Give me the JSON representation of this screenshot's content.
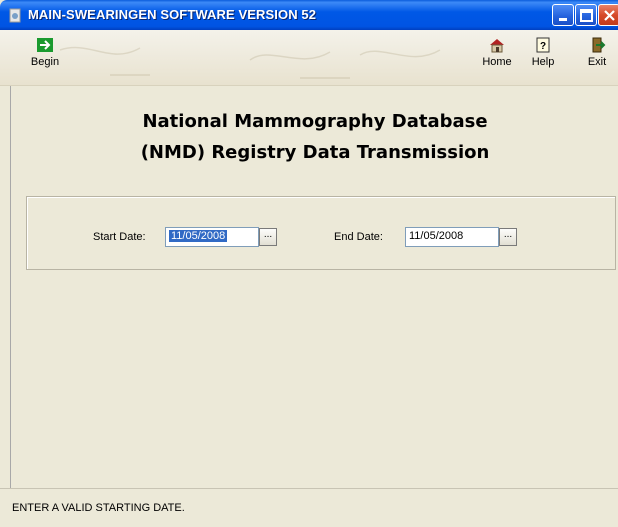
{
  "window": {
    "title": "MAIN-SWEARINGEN SOFTWARE VERSION 52"
  },
  "toolbar": {
    "begin_label": "Begin",
    "begin_icon": "arrow-right-icon",
    "home_label": "Home",
    "home_icon": "home-icon",
    "help_label": "Help",
    "help_icon": "help-icon",
    "exit_label": "Exit",
    "exit_icon": "exit-door-icon"
  },
  "main": {
    "heading_line1": "National Mammography Database",
    "heading_line2": "(NMD) Registry Data Transmission"
  },
  "dates": {
    "start_label": "Start Date:",
    "start_value": "11/05/2008",
    "end_label": "End Date:",
    "end_value": "11/05/2008",
    "picker_label": "..."
  },
  "status": {
    "message": "ENTER A VALID STARTING DATE."
  },
  "colors": {
    "titlebar": "#0054e3",
    "selection": "#316ac5",
    "begin_arrow": "#1a9a2e"
  }
}
